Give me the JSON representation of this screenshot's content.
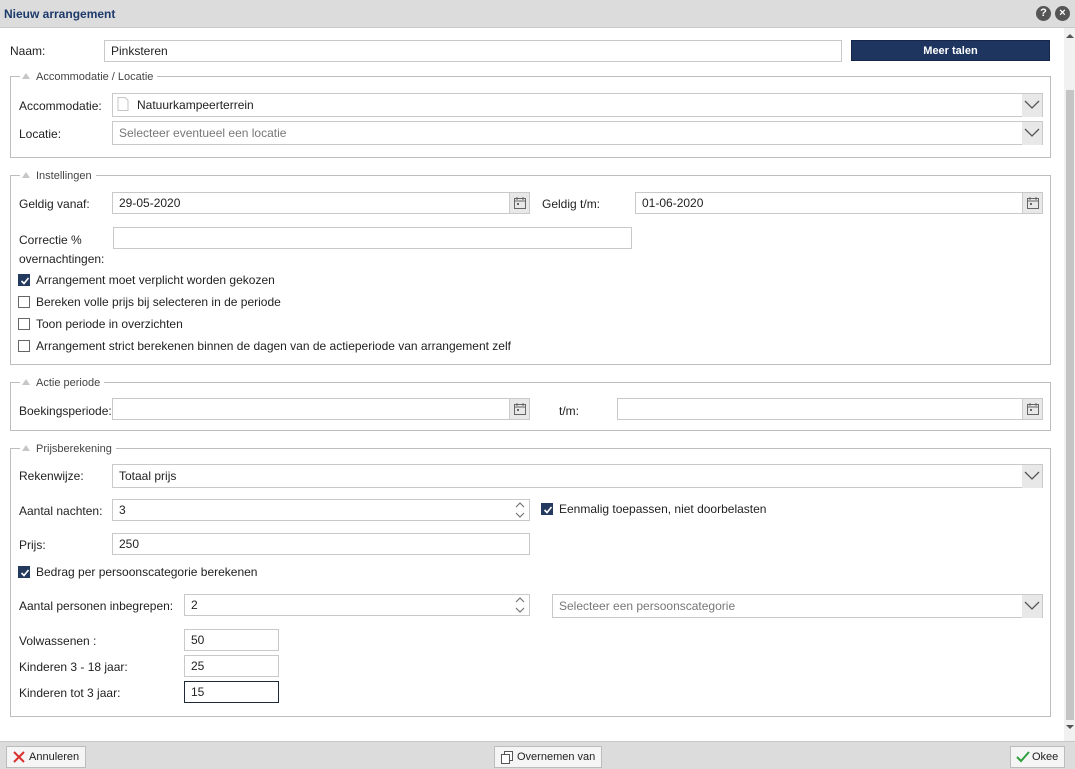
{
  "dialog": {
    "title": "Nieuw arrangement",
    "help_icon": "help-icon",
    "close_icon": "close-icon"
  },
  "naam": {
    "label": "Naam:",
    "value": "Pinksteren",
    "button": "Meer talen"
  },
  "accommodatie_section": {
    "legend": "Accommodatie / Locatie",
    "accommodatie_label": "Accommodatie:",
    "accommodatie_value": "Natuurkampeerterrein",
    "locatie_label": "Locatie:",
    "locatie_placeholder": "Selecteer eventueel een locatie"
  },
  "instellingen": {
    "legend": "Instellingen",
    "geldig_vanaf_label": "Geldig vanaf:",
    "geldig_vanaf_value": "29-05-2020",
    "geldig_tm_label": "Geldig t/m:",
    "geldig_tm_value": "01-06-2020",
    "correctie_label_1": "Correctie %",
    "correctie_label_2": "overnachtingen:",
    "correctie_value": "",
    "checkboxes": [
      {
        "label": "Arrangement moet verplicht worden gekozen",
        "checked": true
      },
      {
        "label": "Bereken volle prijs bij selecteren in de periode",
        "checked": false
      },
      {
        "label": "Toon periode in overzichten",
        "checked": false
      },
      {
        "label": "Arrangement strict berekenen binnen de dagen van de actieperiode van arrangement zelf",
        "checked": false
      }
    ]
  },
  "actie_periode": {
    "legend": "Actie periode",
    "boekingsperiode_label": "Boekingsperiode:",
    "boekingsperiode_value": "",
    "tm_label": "t/m:",
    "tm_value": ""
  },
  "prijsberekening": {
    "legend": "Prijsberekening",
    "rekenwijze_label": "Rekenwijze:",
    "rekenwijze_value": "Totaal prijs",
    "aantal_nachten_label": "Aantal nachten:",
    "aantal_nachten_value": "3",
    "eenmalig_label": "Eenmalig toepassen, niet doorbelasten",
    "eenmalig_checked": true,
    "prijs_label": "Prijs:",
    "prijs_value": "250",
    "bedrag_label": "Bedrag per persoonscategorie berekenen",
    "bedrag_checked": true,
    "aantal_personen_label": "Aantal personen inbegrepen:",
    "aantal_personen_value": "2",
    "persoonscategorie_placeholder": "Selecteer een persoonscategorie",
    "categories": [
      {
        "label": "Volwassenen :",
        "value": "50"
      },
      {
        "label": "Kinderen 3 - 18 jaar:",
        "value": "25"
      },
      {
        "label": "Kinderen tot 3 jaar:",
        "value": "15"
      }
    ]
  },
  "footer": {
    "annuleren": "Annuleren",
    "overnemen": "Overnemen van",
    "okee": "Okee"
  },
  "colors": {
    "accent": "#1e3560",
    "titlebar": "#dcdcdc",
    "title_text": "#1e3a6b",
    "cancel_red": "#d9302c",
    "ok_green": "#2e9e3e"
  }
}
